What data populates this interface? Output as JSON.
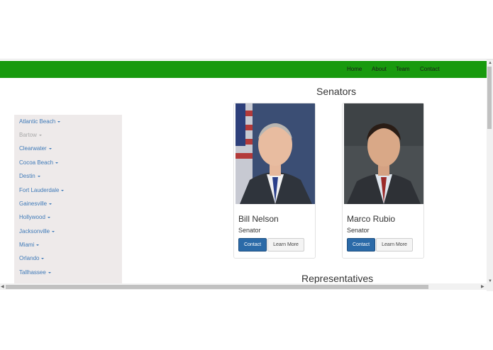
{
  "nav": {
    "home": "Home",
    "about": "About",
    "team": "Team",
    "contact": "Contact"
  },
  "sidebar": {
    "cities": [
      {
        "label": "Atlantic Beach",
        "disabled": false
      },
      {
        "label": "Bartow",
        "disabled": true
      },
      {
        "label": "Clearwater",
        "disabled": false
      },
      {
        "label": "Cocoa Beach",
        "disabled": false
      },
      {
        "label": "Destin",
        "disabled": false
      },
      {
        "label": "Fort Lauderdale",
        "disabled": false
      },
      {
        "label": "Gainesville",
        "disabled": false
      },
      {
        "label": "Hollywood",
        "disabled": false
      },
      {
        "label": "Jacksonville",
        "disabled": false
      },
      {
        "label": "Miami",
        "disabled": false
      },
      {
        "label": "Orlando",
        "disabled": false
      },
      {
        "label": "Tallhassee",
        "disabled": false
      }
    ]
  },
  "senators": {
    "title": "Senators",
    "cards": [
      {
        "name": "Bill Nelson",
        "role": "Senator",
        "contact_label": "Contact",
        "learn_label": "Learn More"
      },
      {
        "name": "Marco Rubio",
        "role": "Senator",
        "contact_label": "Contact",
        "learn_label": "Learn More"
      }
    ]
  },
  "representatives": {
    "title": "Representatives"
  },
  "colors": {
    "navbar": "#189a0e",
    "sidebar_bg": "#eeeaea",
    "link": "#3f7ab8",
    "primary_button": "#2b6aa8"
  }
}
